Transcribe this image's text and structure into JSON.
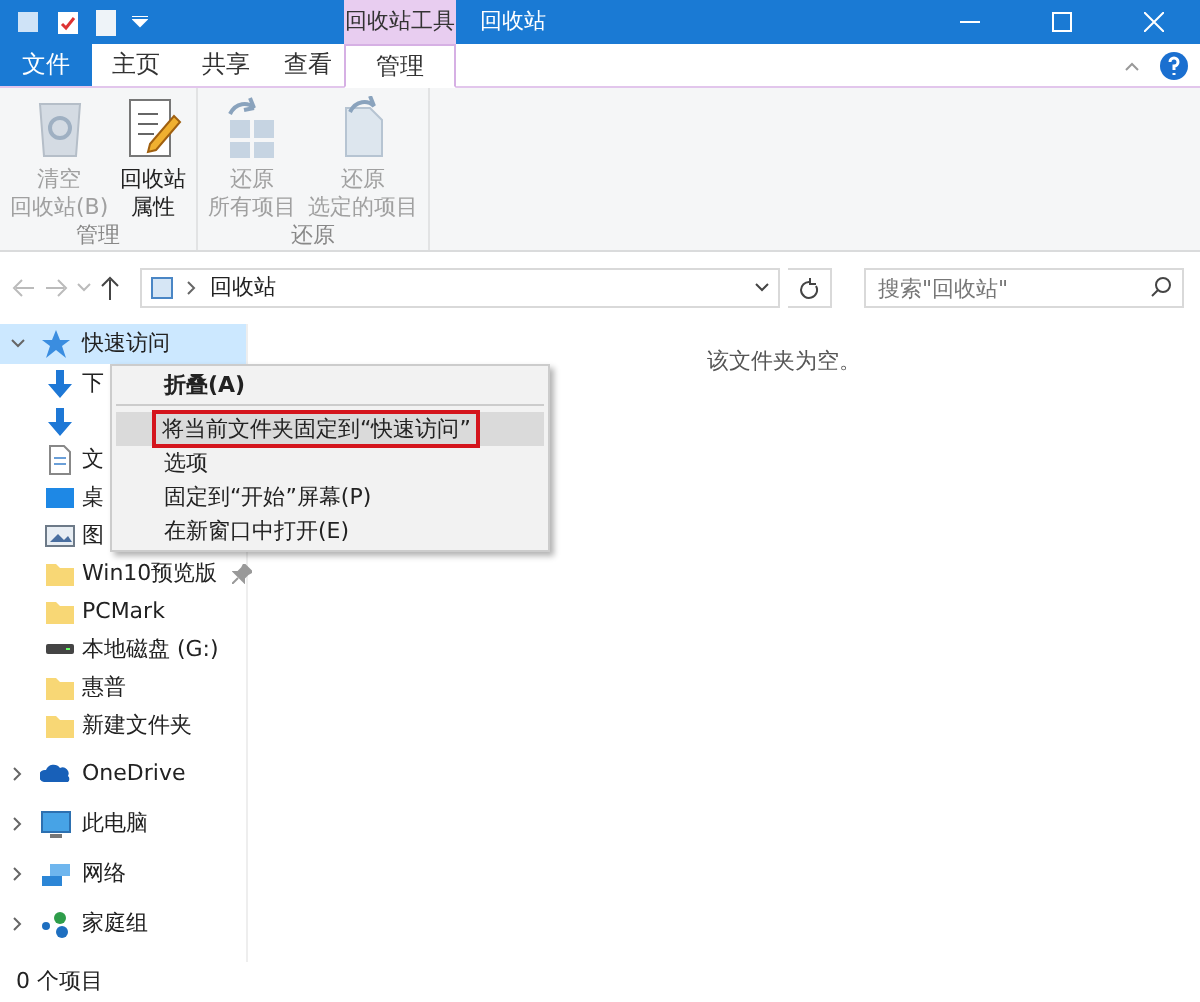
{
  "window": {
    "title": "回收站",
    "context_tab": "回收站工具"
  },
  "ribbon_tabs": [
    {
      "label": "文件",
      "kind": "file",
      "selected": false
    },
    {
      "label": "主页",
      "kind": "tab",
      "selected": false
    },
    {
      "label": "共享",
      "kind": "tab",
      "selected": false
    },
    {
      "label": "查看",
      "kind": "tab",
      "selected": false
    },
    {
      "label": "管理",
      "kind": "context",
      "selected": true
    }
  ],
  "ribbon_groups": [
    {
      "label": "管理",
      "buttons": [
        {
          "lines": [
            "清空",
            "回收站(B)"
          ],
          "disabled": true
        },
        {
          "lines": [
            "回收站",
            "属性"
          ],
          "disabled": false
        }
      ]
    },
    {
      "label": "还原",
      "buttons": [
        {
          "lines": [
            "还原",
            "所有项目"
          ],
          "disabled": true
        },
        {
          "lines": [
            "还原",
            "选定的项目"
          ],
          "disabled": true
        }
      ]
    }
  ],
  "address": {
    "path": "回收站"
  },
  "search": {
    "placeholder": "搜索\"回收站\""
  },
  "sidebar": {
    "items": [
      {
        "label": "快速访问",
        "expanded": true,
        "selected": true,
        "children": [
          {
            "label": "下",
            "pinned": false
          },
          {
            "pinned": false
          },
          {
            "label": "文",
            "pinned": false
          },
          {
            "label": "桌",
            "pinned": false
          },
          {
            "label": "图",
            "pinned": false
          },
          {
            "label": "Win10预览版",
            "pinned": true
          },
          {
            "label": "PCMark",
            "pinned": false
          },
          {
            "label": "本地磁盘 (G:)",
            "pinned": false
          },
          {
            "label": "惠普",
            "pinned": false
          },
          {
            "label": "新建文件夹",
            "pinned": false
          }
        ]
      },
      {
        "label": "OneDrive",
        "expanded": false,
        "selected": false
      },
      {
        "label": "此电脑",
        "expanded": false,
        "selected": false
      },
      {
        "label": "网络",
        "expanded": false,
        "selected": false
      },
      {
        "label": "家庭组",
        "expanded": false,
        "selected": false
      }
    ]
  },
  "content": {
    "empty_message": "该文件夹为空。"
  },
  "context_menu": {
    "items": [
      {
        "label": "折叠(A)",
        "bold": true,
        "separator_after": true,
        "highlighted": false
      },
      {
        "label": "将当前文件夹固定到“快速访问”",
        "bold": false,
        "separator_after": false,
        "highlighted": true
      },
      {
        "label": "选项",
        "bold": false,
        "separator_after": false,
        "highlighted": false
      },
      {
        "label": "固定到“开始”屏幕(P)",
        "bold": false,
        "separator_after": false,
        "highlighted": false
      },
      {
        "label": "在新窗口中打开(E)",
        "bold": false,
        "separator_after": false,
        "highlighted": false
      }
    ]
  },
  "status_bar": {
    "text": "0 个项目"
  }
}
